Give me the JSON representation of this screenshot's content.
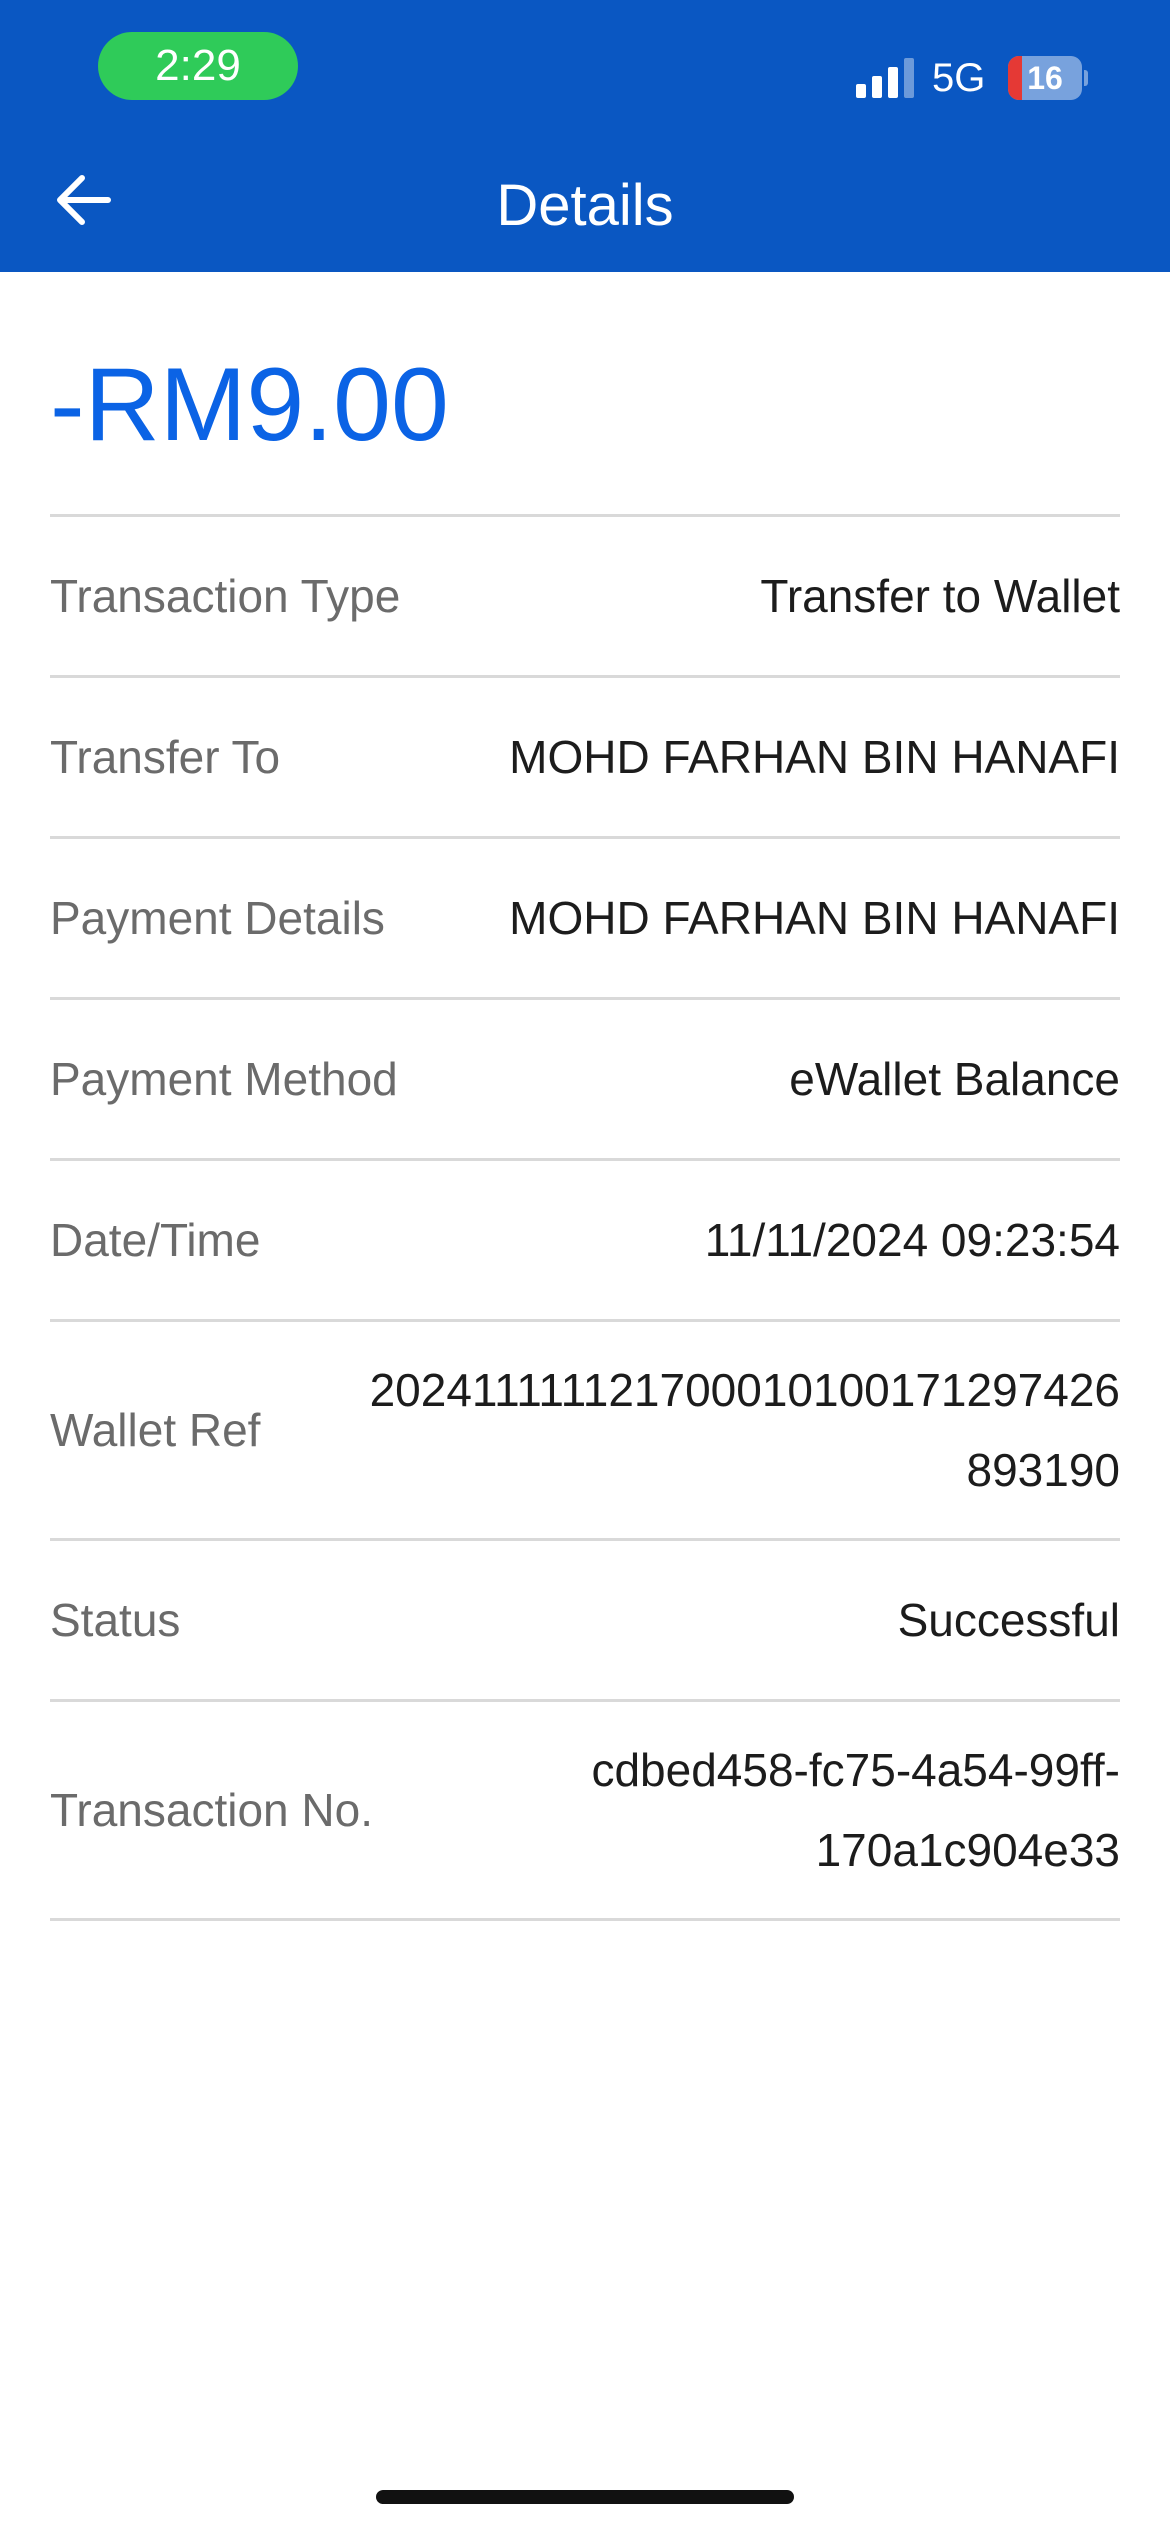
{
  "status_bar": {
    "time": "2:29",
    "network": "5G",
    "battery": "16"
  },
  "header": {
    "title": "Details",
    "back_icon": "arrow-left-icon"
  },
  "amount": "-RM9.00",
  "details": [
    {
      "label": "Transaction Type",
      "value": "Transfer to Wallet"
    },
    {
      "label": "Transfer To",
      "value": "MOHD FARHAN BIN HANAFI"
    },
    {
      "label": "Payment Details",
      "value": "MOHD FARHAN BIN HANAFI"
    },
    {
      "label": "Payment Method",
      "value": "eWallet Balance"
    },
    {
      "label": "Date/Time",
      "value": "11/11/2024 09:23:54"
    },
    {
      "label": "Wallet Ref",
      "value_line1": "202411111121700010100171297426",
      "value_line2": "893190"
    },
    {
      "label": "Status",
      "value": "Successful"
    },
    {
      "label": "Transaction No.",
      "value_line1": "cdbed458-fc75-4a54-99ff-",
      "value_line2": "170a1c904e33"
    }
  ],
  "colors": {
    "header_bg": "#0a57c2",
    "amount": "#0b63e5",
    "time_pill": "#2fcb59",
    "battery_low": "#e53935"
  }
}
